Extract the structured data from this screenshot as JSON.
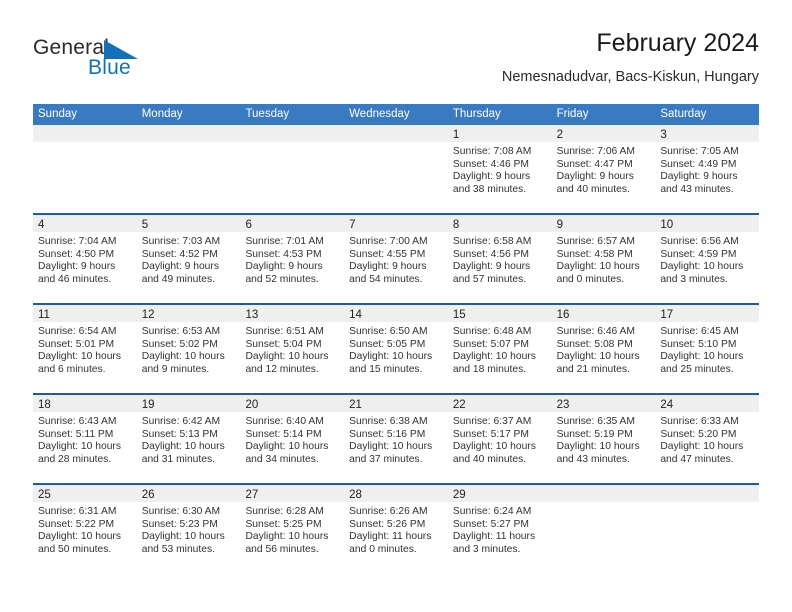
{
  "brand": {
    "name_part1": "General",
    "name_part2": "Blue",
    "triangle_color": "#1271b8"
  },
  "header": {
    "title": "February 2024",
    "subtitle": "Nemesnadudvar, Bacs-Kiskun, Hungary"
  },
  "colors": {
    "header_blue": "#3a7ac0",
    "row_separator_blue": "#1f5c9e",
    "daynum_band_gray": "#efefef",
    "brand_blue": "#1271b8"
  },
  "day_headers": [
    "Sunday",
    "Monday",
    "Tuesday",
    "Wednesday",
    "Thursday",
    "Friday",
    "Saturday"
  ],
  "weeks": [
    [
      {
        "day": "",
        "lines": [
          "",
          "",
          "",
          ""
        ]
      },
      {
        "day": "",
        "lines": [
          "",
          "",
          "",
          ""
        ]
      },
      {
        "day": "",
        "lines": [
          "",
          "",
          "",
          ""
        ]
      },
      {
        "day": "",
        "lines": [
          "",
          "",
          "",
          ""
        ]
      },
      {
        "day": "1",
        "lines": [
          "Sunrise: 7:08 AM",
          "Sunset: 4:46 PM",
          "Daylight: 9 hours",
          "and 38 minutes."
        ]
      },
      {
        "day": "2",
        "lines": [
          "Sunrise: 7:06 AM",
          "Sunset: 4:47 PM",
          "Daylight: 9 hours",
          "and 40 minutes."
        ]
      },
      {
        "day": "3",
        "lines": [
          "Sunrise: 7:05 AM",
          "Sunset: 4:49 PM",
          "Daylight: 9 hours",
          "and 43 minutes."
        ]
      }
    ],
    [
      {
        "day": "4",
        "lines": [
          "Sunrise: 7:04 AM",
          "Sunset: 4:50 PM",
          "Daylight: 9 hours",
          "and 46 minutes."
        ]
      },
      {
        "day": "5",
        "lines": [
          "Sunrise: 7:03 AM",
          "Sunset: 4:52 PM",
          "Daylight: 9 hours",
          "and 49 minutes."
        ]
      },
      {
        "day": "6",
        "lines": [
          "Sunrise: 7:01 AM",
          "Sunset: 4:53 PM",
          "Daylight: 9 hours",
          "and 52 minutes."
        ]
      },
      {
        "day": "7",
        "lines": [
          "Sunrise: 7:00 AM",
          "Sunset: 4:55 PM",
          "Daylight: 9 hours",
          "and 54 minutes."
        ]
      },
      {
        "day": "8",
        "lines": [
          "Sunrise: 6:58 AM",
          "Sunset: 4:56 PM",
          "Daylight: 9 hours",
          "and 57 minutes."
        ]
      },
      {
        "day": "9",
        "lines": [
          "Sunrise: 6:57 AM",
          "Sunset: 4:58 PM",
          "Daylight: 10 hours",
          "and 0 minutes."
        ]
      },
      {
        "day": "10",
        "lines": [
          "Sunrise: 6:56 AM",
          "Sunset: 4:59 PM",
          "Daylight: 10 hours",
          "and 3 minutes."
        ]
      }
    ],
    [
      {
        "day": "11",
        "lines": [
          "Sunrise: 6:54 AM",
          "Sunset: 5:01 PM",
          "Daylight: 10 hours",
          "and 6 minutes."
        ]
      },
      {
        "day": "12",
        "lines": [
          "Sunrise: 6:53 AM",
          "Sunset: 5:02 PM",
          "Daylight: 10 hours",
          "and 9 minutes."
        ]
      },
      {
        "day": "13",
        "lines": [
          "Sunrise: 6:51 AM",
          "Sunset: 5:04 PM",
          "Daylight: 10 hours",
          "and 12 minutes."
        ]
      },
      {
        "day": "14",
        "lines": [
          "Sunrise: 6:50 AM",
          "Sunset: 5:05 PM",
          "Daylight: 10 hours",
          "and 15 minutes."
        ]
      },
      {
        "day": "15",
        "lines": [
          "Sunrise: 6:48 AM",
          "Sunset: 5:07 PM",
          "Daylight: 10 hours",
          "and 18 minutes."
        ]
      },
      {
        "day": "16",
        "lines": [
          "Sunrise: 6:46 AM",
          "Sunset: 5:08 PM",
          "Daylight: 10 hours",
          "and 21 minutes."
        ]
      },
      {
        "day": "17",
        "lines": [
          "Sunrise: 6:45 AM",
          "Sunset: 5:10 PM",
          "Daylight: 10 hours",
          "and 25 minutes."
        ]
      }
    ],
    [
      {
        "day": "18",
        "lines": [
          "Sunrise: 6:43 AM",
          "Sunset: 5:11 PM",
          "Daylight: 10 hours",
          "and 28 minutes."
        ]
      },
      {
        "day": "19",
        "lines": [
          "Sunrise: 6:42 AM",
          "Sunset: 5:13 PM",
          "Daylight: 10 hours",
          "and 31 minutes."
        ]
      },
      {
        "day": "20",
        "lines": [
          "Sunrise: 6:40 AM",
          "Sunset: 5:14 PM",
          "Daylight: 10 hours",
          "and 34 minutes."
        ]
      },
      {
        "day": "21",
        "lines": [
          "Sunrise: 6:38 AM",
          "Sunset: 5:16 PM",
          "Daylight: 10 hours",
          "and 37 minutes."
        ]
      },
      {
        "day": "22",
        "lines": [
          "Sunrise: 6:37 AM",
          "Sunset: 5:17 PM",
          "Daylight: 10 hours",
          "and 40 minutes."
        ]
      },
      {
        "day": "23",
        "lines": [
          "Sunrise: 6:35 AM",
          "Sunset: 5:19 PM",
          "Daylight: 10 hours",
          "and 43 minutes."
        ]
      },
      {
        "day": "24",
        "lines": [
          "Sunrise: 6:33 AM",
          "Sunset: 5:20 PM",
          "Daylight: 10 hours",
          "and 47 minutes."
        ]
      }
    ],
    [
      {
        "day": "25",
        "lines": [
          "Sunrise: 6:31 AM",
          "Sunset: 5:22 PM",
          "Daylight: 10 hours",
          "and 50 minutes."
        ]
      },
      {
        "day": "26",
        "lines": [
          "Sunrise: 6:30 AM",
          "Sunset: 5:23 PM",
          "Daylight: 10 hours",
          "and 53 minutes."
        ]
      },
      {
        "day": "27",
        "lines": [
          "Sunrise: 6:28 AM",
          "Sunset: 5:25 PM",
          "Daylight: 10 hours",
          "and 56 minutes."
        ]
      },
      {
        "day": "28",
        "lines": [
          "Sunrise: 6:26 AM",
          "Sunset: 5:26 PM",
          "Daylight: 11 hours",
          "and 0 minutes."
        ]
      },
      {
        "day": "29",
        "lines": [
          "Sunrise: 6:24 AM",
          "Sunset: 5:27 PM",
          "Daylight: 11 hours",
          "and 3 minutes."
        ]
      },
      {
        "day": "",
        "lines": [
          "",
          "",
          "",
          ""
        ]
      },
      {
        "day": "",
        "lines": [
          "",
          "",
          "",
          ""
        ]
      }
    ]
  ]
}
